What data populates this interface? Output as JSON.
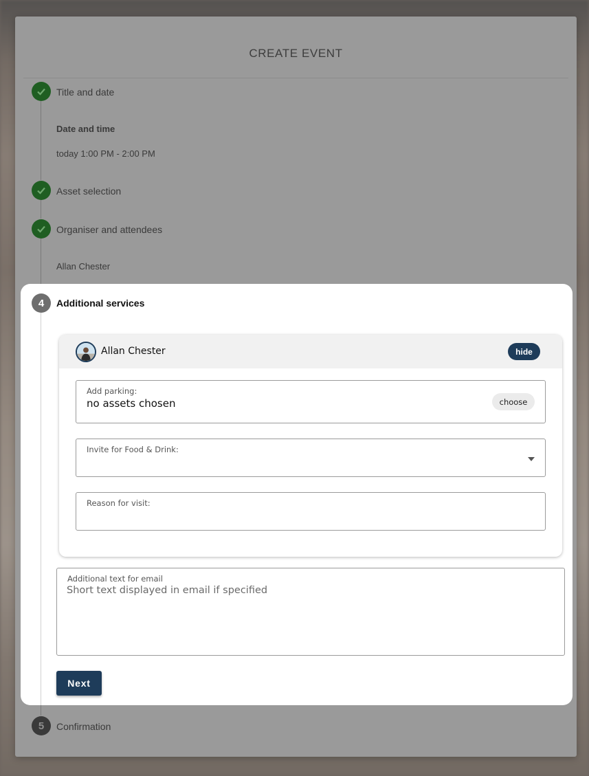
{
  "dialog": {
    "title": "CREATE EVENT"
  },
  "steps": {
    "step1": {
      "label": "Title and date",
      "status": "complete",
      "detail_heading": "Date and time",
      "detail_value": "today 1:00 PM - 2:00 PM"
    },
    "step2": {
      "label": "Asset selection",
      "status": "complete"
    },
    "step3": {
      "label": "Organiser and attendees",
      "status": "complete",
      "detail_value": "Allan Chester"
    },
    "step4": {
      "number": "4",
      "label": "Additional services",
      "status": "active"
    },
    "step5": {
      "number": "5",
      "label": "Confirmation",
      "status": "pending"
    }
  },
  "attendee": {
    "name": "Allan Chester",
    "hide_label": "hide",
    "parking": {
      "label": "Add parking:",
      "value": "no assets chosen",
      "choose_label": "choose"
    },
    "food": {
      "label": "Invite for Food & Drink:",
      "value": ""
    },
    "reason": {
      "label": "Reason for visit:",
      "value": ""
    }
  },
  "email": {
    "label": "Additional text for email",
    "placeholder": "Short text displayed in email if specified"
  },
  "next_label": "Next",
  "colors": {
    "primary": "#1e3c5a",
    "success": "#1f5e22"
  }
}
